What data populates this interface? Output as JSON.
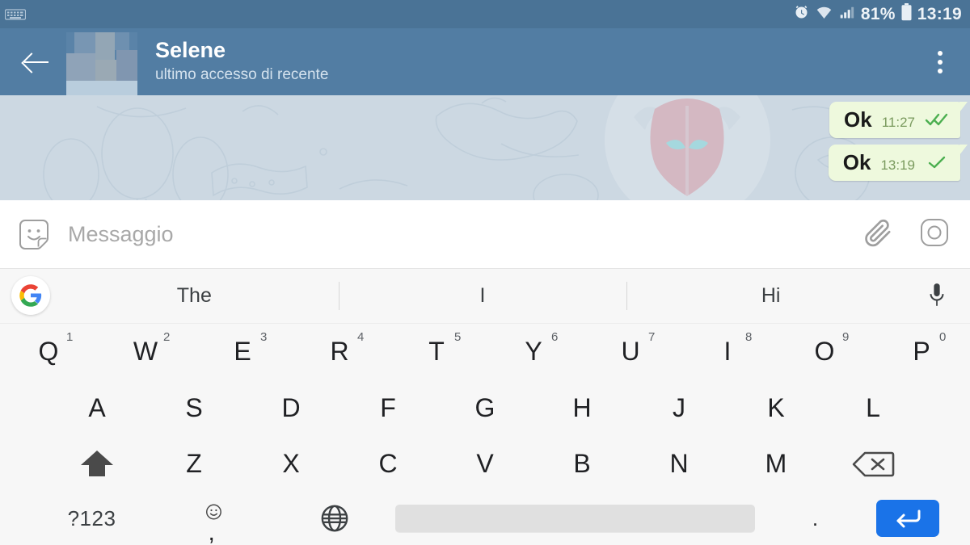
{
  "status_bar": {
    "notification_icon": "keyboard-icon",
    "icons": [
      "alarm-icon",
      "wifi-icon",
      "signal-icon",
      "battery-icon"
    ],
    "battery": "81%",
    "time": "13:19",
    "background_color": "#4a7396"
  },
  "app_bar": {
    "back_label": "back-arrow",
    "title": "Selene",
    "subtitle": "ultimo accesso di recente",
    "avatar": "blurred-avatar",
    "overflow": "more-options",
    "background_color": "#527da3"
  },
  "chat": {
    "background_color": "#ccd8e2",
    "watermark": "horned-mask-avatar-watermark",
    "messages": [
      {
        "text": "Ok",
        "time": "11:27",
        "ticks": "double",
        "outgoing": true
      },
      {
        "text": "Ok",
        "time": "13:19",
        "ticks": "single",
        "outgoing": true
      }
    ],
    "bubble_color": "#eef9dd",
    "tick_color": "#4caf50"
  },
  "composer": {
    "emoji_icon": "sticker-smiley-icon",
    "placeholder": "Messaggio",
    "value": "",
    "attach_icon": "paperclip-icon",
    "camera_icon": "camera-icon"
  },
  "keyboard": {
    "assistant_icon": "google-g-icon",
    "suggestions": [
      "The",
      "I",
      "Hi"
    ],
    "mic_icon": "microphone-icon",
    "row1": [
      {
        "letter": "Q",
        "num": "1"
      },
      {
        "letter": "W",
        "num": "2"
      },
      {
        "letter": "E",
        "num": "3"
      },
      {
        "letter": "R",
        "num": "4"
      },
      {
        "letter": "T",
        "num": "5"
      },
      {
        "letter": "Y",
        "num": "6"
      },
      {
        "letter": "U",
        "num": "7"
      },
      {
        "letter": "I",
        "num": "8"
      },
      {
        "letter": "O",
        "num": "9"
      },
      {
        "letter": "P",
        "num": "0"
      }
    ],
    "row2": [
      "A",
      "S",
      "D",
      "F",
      "G",
      "H",
      "J",
      "K",
      "L"
    ],
    "row3": {
      "shift": "shift-key",
      "letters": [
        "Z",
        "X",
        "C",
        "V",
        "B",
        "N",
        "M"
      ],
      "delete": "backspace-key"
    },
    "row4": {
      "symbols_label": "?123",
      "comma_label": ",",
      "comma_emoji": "emoji-key",
      "globe_label": "language-globe",
      "space_label": "",
      "period_label": ".",
      "enter_label": "enter-key"
    },
    "background_color": "#f7f7f7",
    "enter_color": "#1a73e8",
    "spacebar_color": "#e0e0e0"
  }
}
